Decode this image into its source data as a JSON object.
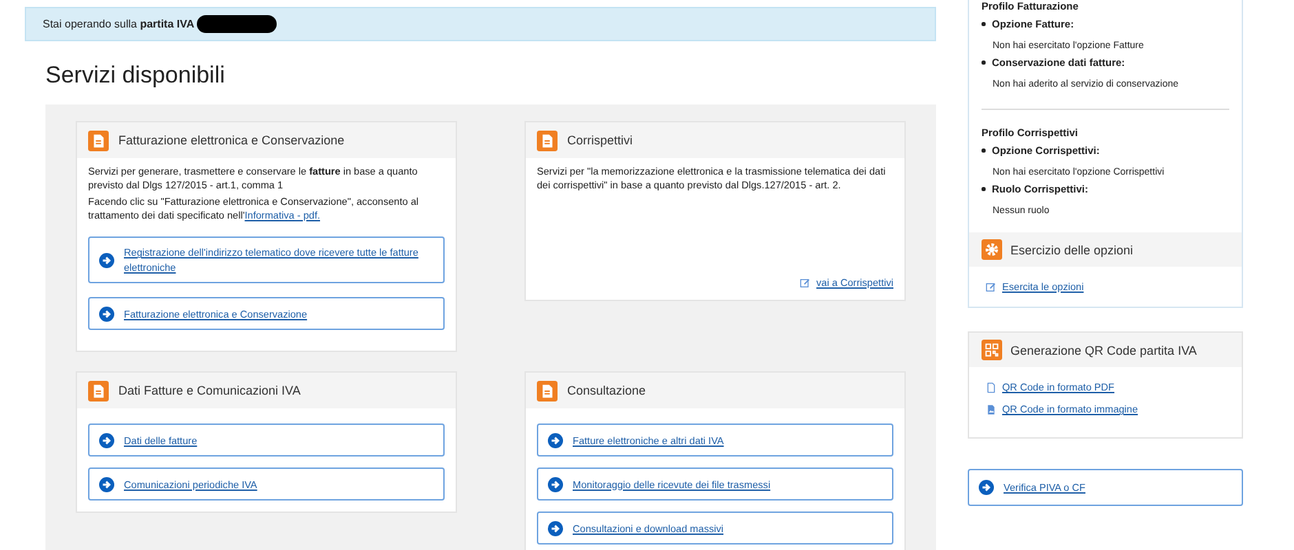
{
  "alert": {
    "text": "Stai operando sulla **partita IVA**"
  },
  "heading": "Servizi disponibili",
  "services": [
    {
      "title": "Fatturazione elettronica e Conservazione",
      "description": "Servizi per generare, trasmettere e conservare le **fatture** in base a quanto previsto dal Dlgs 127/2015 - art.1, comma 1",
      "consent_text": "Facendo clic su \"Fatturazione elettronica e Conservazione\", acconsento al trattamento dei dati specificato nell'",
      "consent_link": "Informativa - pdf.",
      "links": [
        "Registrazione dell'indirizzo telematico dove ricevere tutte le fatture elettroniche",
        "Fatturazione elettronica e Conservazione"
      ]
    },
    {
      "title": "Corrispettivi",
      "description": "Servizi per \"la memorizzazione elettronica e la trasmissione telematica dei dati dei corrispettivi\" in base a quanto previsto dal Dlgs.127/2015 - art. 2.",
      "footer_link": "vai a Corrispettivi"
    },
    {
      "title": "Dati Fatture e Comunicazioni IVA",
      "links": [
        "Dati delle fatture",
        "Comunicazioni periodiche IVA"
      ]
    },
    {
      "title": "Consultazione",
      "links": [
        "Fatture elettroniche e altri dati IVA",
        "Monitoraggio delle ricevute dei file trasmessi",
        "Consultazioni e download massivi"
      ]
    }
  ],
  "profiles": [
    {
      "title": "Profilo Fatturazione",
      "items": [
        {
          "label": "Opzione Fatture:",
          "value": "Non hai esercitato l'opzione Fatture"
        },
        {
          "label": "Conservazione dati fatture:",
          "value": "Non hai aderito al servizio di conservazione"
        }
      ]
    },
    {
      "title": "Profilo Corrispettivi",
      "items": [
        {
          "label": "Opzione Corrispettivi:",
          "value": "Non hai esercitato l'opzione Corrispettivi"
        },
        {
          "label": "Ruolo Corrispettivi:",
          "value": "Nessun ruolo"
        }
      ]
    }
  ],
  "options": {
    "title": "Esercizio delle opzioni",
    "link": "Esercita le opzioni"
  },
  "qr": {
    "title": "Generazione QR Code partita IVA",
    "links": [
      {
        "text": "QR Code in formato PDF",
        "kind": "pdf"
      },
      {
        "text": "QR Code in formato immagine",
        "kind": "image"
      }
    ]
  },
  "verify_button": "Verifica PIVA o CF"
}
